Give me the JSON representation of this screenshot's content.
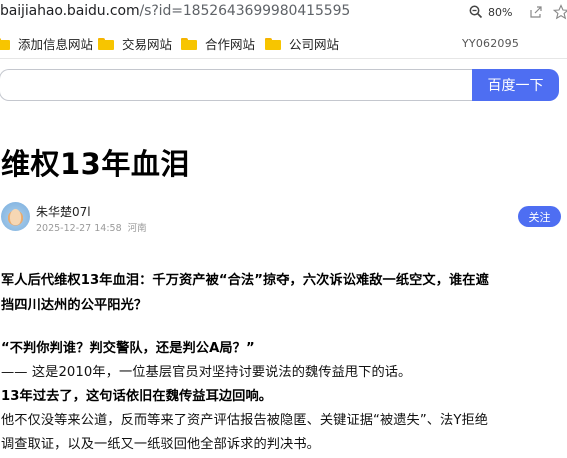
{
  "browser": {
    "url_host": "baijiahao.baidu.com",
    "url_rest": "/s?id=1852643699980415595",
    "zoom": "80%",
    "icons": [
      "zoom-icon",
      "share-icon",
      "favorite-icon"
    ]
  },
  "bookmarks": {
    "items": [
      "添加信息网站",
      "交易网站",
      "合作网站",
      "公司网站"
    ],
    "tag": "YY062095"
  },
  "search": {
    "input_value": "",
    "button": "百度一下"
  },
  "article": {
    "title": "维权13年血泪",
    "author": "朱华楚07l",
    "date": "2025-12-27 14:58",
    "location": "河南",
    "follow": "关注",
    "para1_line1": "军人后代维权13年血泪：千万资产被“合法”掠夺，六次诉讼难敌一纸空文，谁在遮",
    "para1_line2": "挡四川达州的公平阳光？",
    "quote": "“不判你判谁？判交警队，还是判公A局？”",
    "line3": "—— 这是2010年，一位基层官员对坚持讨要说法的魏传益甩下的话。",
    "line4": "13年过去了，这句话依旧在魏传益耳边回响。",
    "line5": "他不仅没等来公道，反而等来了资产评估报告被隐匿、关键证据“被遗失”、法Y拒绝",
    "line6": "调查取证，以及一纸又一纸驳回他全部诉求的判决书。"
  }
}
